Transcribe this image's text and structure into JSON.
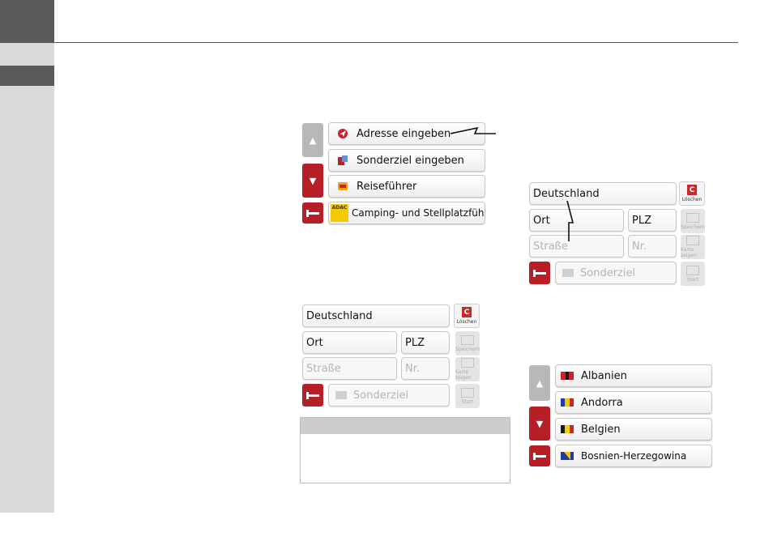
{
  "main_menu": {
    "items": [
      {
        "label": "Adresse eingeben",
        "icon": "navigation-arrow-icon"
      },
      {
        "label": "Sonderziel eingeben",
        "icon": "poi-icon"
      },
      {
        "label": "Reiseführer",
        "icon": "travel-guide-icon"
      },
      {
        "label": "Camping- und Stellplatzführer",
        "icon": "adac-logo",
        "logo_text": "ADAC"
      }
    ],
    "up_icon": "chevron-up-icon",
    "down_icon": "chevron-down-icon",
    "back_icon": "back-arrow-icon"
  },
  "address_form": {
    "country": "Deutschland",
    "city_placeholder": "Ort",
    "zip_placeholder": "PLZ",
    "street_placeholder": "Straße",
    "number_placeholder": "Nr.",
    "poi_label": "Sonderziel",
    "delete_label": "Löschen",
    "save_label": "Speichern",
    "map_label": "Karte zeigen",
    "start_label": "Start"
  },
  "country_list": {
    "items": [
      {
        "label": "Albanien",
        "flag_colors": [
          "#d0202a",
          "#1a1a1a",
          "#d0202a"
        ]
      },
      {
        "label": "Andorra",
        "flag_colors": [
          "#1c3f9e",
          "#f5c400",
          "#d0202a"
        ]
      },
      {
        "label": "Belgien",
        "flag_colors": [
          "#1a1a1a",
          "#f5d100",
          "#d0202a"
        ]
      },
      {
        "label": "Bosnien-Herzegowina",
        "flag_colors": [
          "#1f3d9c",
          "#f5c400",
          "#1f3d9c"
        ]
      }
    ]
  },
  "colors": {
    "accent_red": "#b51f25",
    "sidebar_gray": "#d9d9d9",
    "dark_block": "#5a5a5a"
  }
}
